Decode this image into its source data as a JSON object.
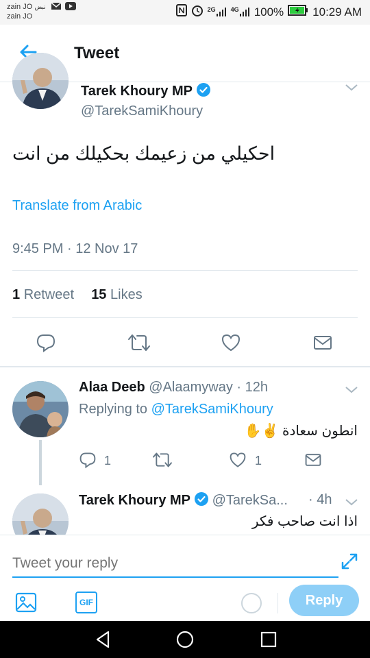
{
  "status_bar": {
    "carrier_1": "zain JO",
    "carrier_1_extra": "نبض",
    "carrier_2": "zain JO",
    "network_2g": "2G",
    "network_4g": "4G",
    "battery": "100%",
    "time": "10:29 AM"
  },
  "header": {
    "title": "Tweet"
  },
  "main_tweet": {
    "author_name": "Tarek Khoury MP",
    "author_handle": "@TarekSamiKhoury",
    "text": "احكيلي من زعيمك بحكيلك من انت",
    "translate_label": "Translate from Arabic",
    "timestamp": "9:45 PM · 12 Nov 17",
    "retweet_count": "1",
    "retweet_label": "Retweet",
    "likes_count": "15",
    "likes_label": "Likes"
  },
  "replies": [
    {
      "author_name": "Alaa Deeb",
      "author_handle": "@Alaamyway",
      "time": "· 12h",
      "replying_to_label": "Replying to",
      "replying_to_handle": "@TarekSamiKhoury",
      "text": "انطون سعادة ✌️✋",
      "reply_count": "1",
      "like_count": "1"
    },
    {
      "author_name": "Tarek Khoury MP",
      "author_handle": "@TarekSa...",
      "time": "· 4h",
      "text": "اذا انت صاحب فكر"
    }
  ],
  "composer": {
    "placeholder": "Tweet your reply",
    "reply_button": "Reply",
    "gif_label": "GIF"
  },
  "colors": {
    "accent": "#1da1f2",
    "reply_button_disabled": "#8ecff7",
    "text_secondary": "#657786"
  }
}
